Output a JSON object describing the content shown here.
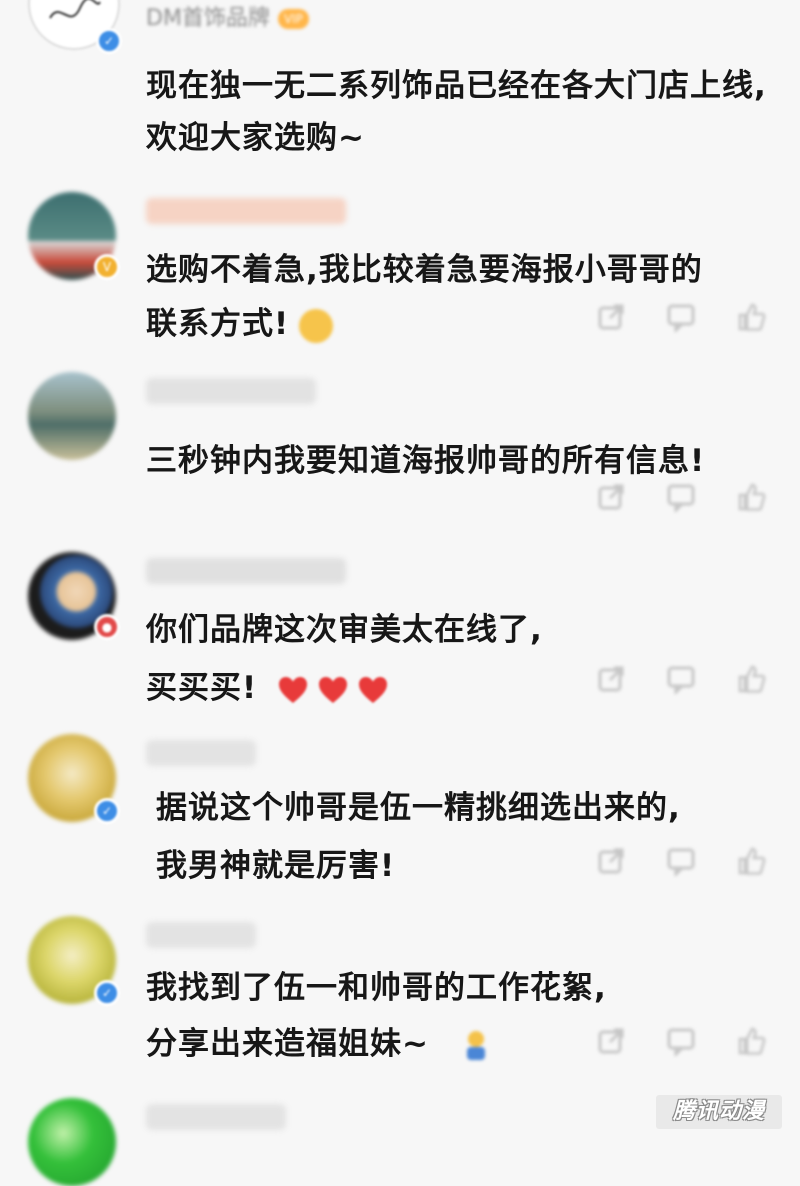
{
  "colors": {
    "background": "#f7f7f7",
    "text": "#171717",
    "verified_blue": "#3e8ee6",
    "accent_red": "#e24a4a"
  },
  "comments": [
    {
      "username": "DM首饰品牌",
      "vip_label": "VIP",
      "badge": "verified",
      "lines": [
        "现在独一无二系列饰品已经在各大门店上线,",
        "欢迎大家选购~"
      ]
    },
    {
      "username": "",
      "badge": "gold-v",
      "lines": [
        "选购不着急,我比较着急要海报小哥哥的",
        "联系方式!"
      ],
      "emoji": "dizzy-face-emoji"
    },
    {
      "username": "",
      "lines": [
        "三秒钟内我要知道海报帅哥的所有信息!"
      ]
    },
    {
      "username": "",
      "badge": "red",
      "lines": [
        "你们品牌这次审美太在线了,",
        "买买买!"
      ],
      "emoji": "three-red-hearts"
    },
    {
      "username": "",
      "badge": "verified",
      "lines": [
        "据说这个帅哥是伍一精挑细选出来的,",
        "我男神就是厉害!"
      ]
    },
    {
      "username": "",
      "badge": "verified",
      "lines": [
        "我找到了伍一和帅哥的工作花絮,",
        "分享出来造福姐妹~"
      ],
      "emoji": "small-figure-emoji"
    },
    {
      "username": "",
      "lines": []
    }
  ],
  "actions": {
    "share_icon": "share-icon",
    "comment_icon": "comment-icon",
    "like_icon": "thumbs-up-icon"
  },
  "watermark": "腾讯动漫"
}
